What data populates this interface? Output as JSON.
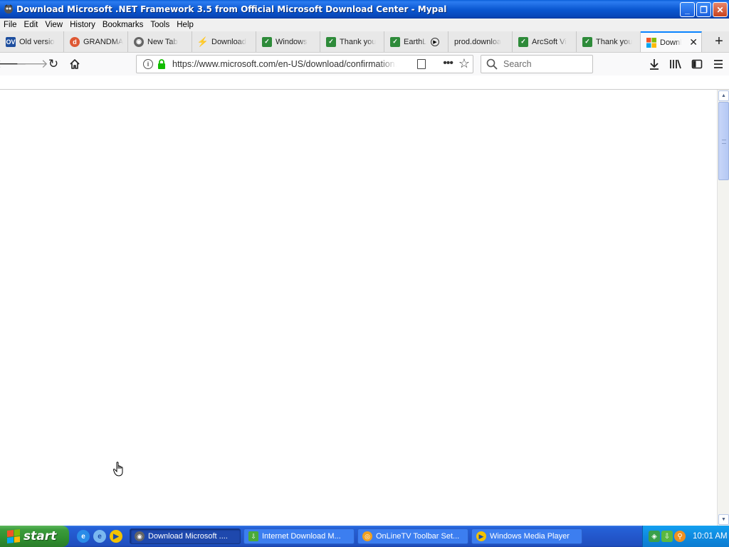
{
  "window": {
    "title": "Download Microsoft .NET Framework 3.5 from Official Microsoft Download Center - Mypal",
    "minimize": "_",
    "maximize": "❐",
    "close": "✕"
  },
  "menu": [
    "File",
    "Edit",
    "View",
    "History",
    "Bookmarks",
    "Tools",
    "Help"
  ],
  "tabs": [
    {
      "label": "Old versio",
      "icon": "ov-icon"
    },
    {
      "label": "GRANDMA",
      "icon": "duckduckgo-icon"
    },
    {
      "label": "New Tab",
      "icon": "raccoon-icon"
    },
    {
      "label": "Download",
      "icon": "lightning-icon"
    },
    {
      "label": "Windows",
      "icon": "green-check-icon"
    },
    {
      "label": "Thank you",
      "icon": "green-check-icon"
    },
    {
      "label": "EarthL",
      "icon": "green-check-icon"
    },
    {
      "label": "prod.downloa",
      "icon": ""
    },
    {
      "label": "ArcSoft Vi",
      "icon": "green-check-icon"
    },
    {
      "label": "Thank you",
      "icon": "green-check-icon"
    },
    {
      "label": "Downl",
      "icon": "microsoft-icon"
    }
  ],
  "navbar": {
    "url": "https://www.microsoft.com/en-US/download/confirmation.aspx",
    "search_placeholder": "Search"
  },
  "taskbar": {
    "start_label": "start",
    "tasks": [
      {
        "label": "Download Microsoft ....",
        "active": true
      },
      {
        "label": "Internet Download M...",
        "active": false
      },
      {
        "label": "OnLineTV Toolbar Set...",
        "active": false
      },
      {
        "label": "Windows Media Player",
        "active": false
      }
    ],
    "clock": "10:01 AM"
  },
  "colors": {
    "titlebar": "#0b58d2",
    "tab_active_accent": "#0a84ff",
    "taskbar": "#2357cc",
    "start_button": "#3c9c3c",
    "tray": "#0f8ae0"
  }
}
